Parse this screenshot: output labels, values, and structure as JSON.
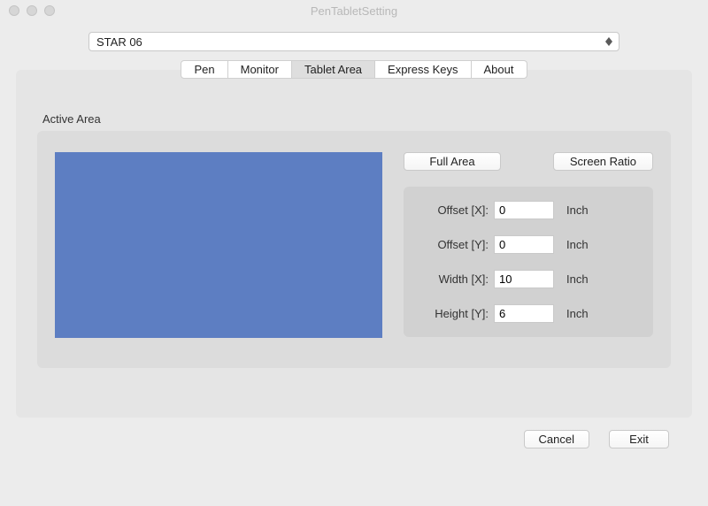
{
  "window": {
    "title": "PenTabletSetting"
  },
  "device_select": {
    "value": "STAR 06"
  },
  "tabs": {
    "pen": "Pen",
    "monitor": "Monitor",
    "tablet_area": "Tablet Area",
    "express_keys": "Express Keys",
    "about": "About",
    "active": "tablet_area"
  },
  "section": {
    "label": "Active Area"
  },
  "buttons": {
    "full_area": "Full Area",
    "screen_ratio": "Screen Ratio"
  },
  "fields": {
    "offset_x": {
      "label": "Offset [X]:",
      "value": "0",
      "unit": "Inch"
    },
    "offset_y": {
      "label": "Offset [Y]:",
      "value": "0",
      "unit": "Inch"
    },
    "width": {
      "label": "Width [X]:",
      "value": "10",
      "unit": "Inch"
    },
    "height": {
      "label": "Height [Y]:",
      "value": "6",
      "unit": "Inch"
    }
  },
  "footer": {
    "cancel": "Cancel",
    "exit": "Exit"
  }
}
